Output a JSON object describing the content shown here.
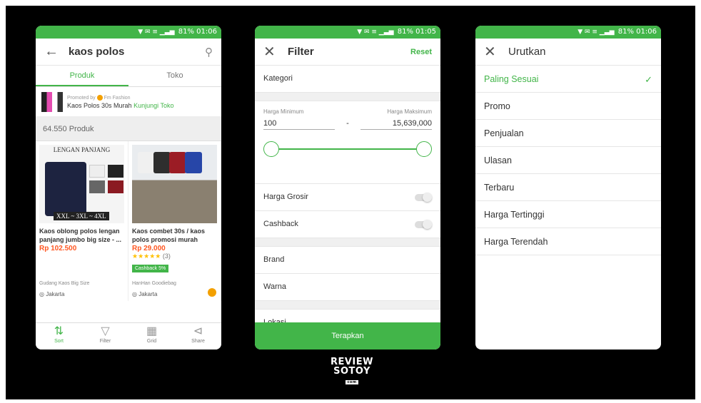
{
  "status": {
    "icons": "▼ ✉ ≡ ▁▃▅",
    "battery": "81%",
    "time_1": "01:06",
    "time_2": "01:05",
    "time_3": "01:06"
  },
  "search_screen": {
    "query": "kaos polos",
    "tabs": [
      "Produk",
      "Toko"
    ],
    "promo": {
      "promoted_by": "Promoted by",
      "store": "Fm Fashion",
      "headline": "Kaos Polos 30s Murah",
      "cta": "Kunjungi Toko"
    },
    "result_count": "64.550 Produk",
    "products": [
      {
        "image_caption": "LENGAN PANJANG",
        "image_size": "XXL ~ 3XL ~ 4XL",
        "name": "Kaos oblong polos lengan panjang jumbo big size - ...",
        "price": "Rp 102.500",
        "shop": "Gudang Kaos Big Size",
        "location": "Jakarta"
      },
      {
        "name": "Kaos combet 30s / kaos polos promosi murah",
        "price": "Rp 29.000",
        "stars": "★★★★★",
        "rating_count": "(3)",
        "cashback": "Cashback 5%",
        "shop": "HanHan Goodiebag",
        "location": "Jakarta"
      }
    ],
    "nav": [
      "Sort",
      "Filter",
      "Grid",
      "Share"
    ]
  },
  "filter_screen": {
    "title": "Filter",
    "reset": "Reset",
    "category": "Kategori",
    "min_label": "Harga Minimum",
    "max_label": "Harga Maksimum",
    "min_value": "100",
    "separator": "-",
    "max_value": "15,639,000",
    "wholesale": "Harga Grosir",
    "cashback": "Cashback",
    "brand": "Brand",
    "color": "Warna",
    "location": "Lokasi",
    "apply": "Terapkan"
  },
  "sort_screen": {
    "title": "Urutkan",
    "options": [
      "Paling Sesuai",
      "Promo",
      "Penjualan",
      "Ulasan",
      "Terbaru",
      "Harga Tertinggi",
      "Harga Terendah"
    ],
    "selected": "Paling Sesuai"
  },
  "watermark": {
    "line1": "REVIEW",
    "line2": "SOTOY",
    "tag": "com"
  },
  "colors": {
    "accent": "#42b549",
    "price": "#ff5722",
    "background": "#000000"
  }
}
